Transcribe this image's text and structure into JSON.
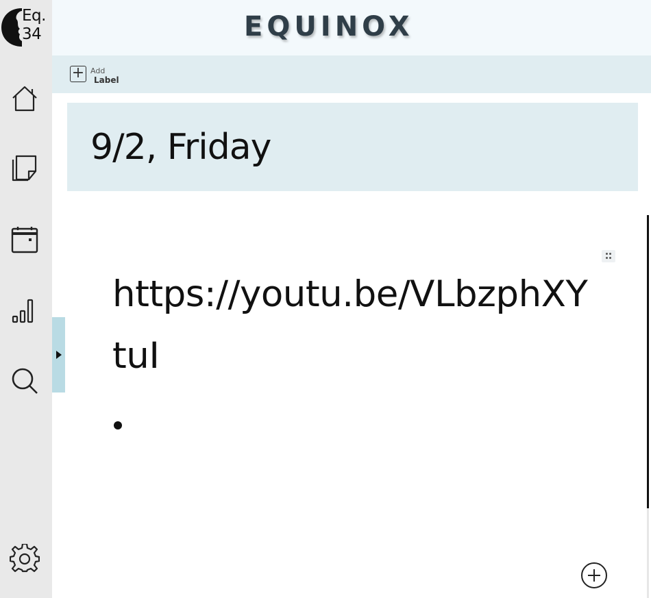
{
  "app": {
    "title": "EQUINOX",
    "logo_line1": "Eq.",
    "logo_line2": "34"
  },
  "sidebar": {
    "items": [
      {
        "name": "home-icon"
      },
      {
        "name": "notes-icon"
      },
      {
        "name": "calendar-icon"
      },
      {
        "name": "stats-icon"
      },
      {
        "name": "search-icon"
      },
      {
        "name": "settings-icon"
      }
    ]
  },
  "label_bar": {
    "add_small": "Add",
    "add_big": "Label"
  },
  "note": {
    "date": "9/2, Friday",
    "content": "https://youtu.be/VLbzphXYtuI"
  },
  "colors": {
    "sidebar": "#e9e9e9",
    "header": "#f3f9fc",
    "label_bar": "#e0edf1",
    "drawer_handle": "#b9dbe4",
    "title": "#2f3e48"
  }
}
